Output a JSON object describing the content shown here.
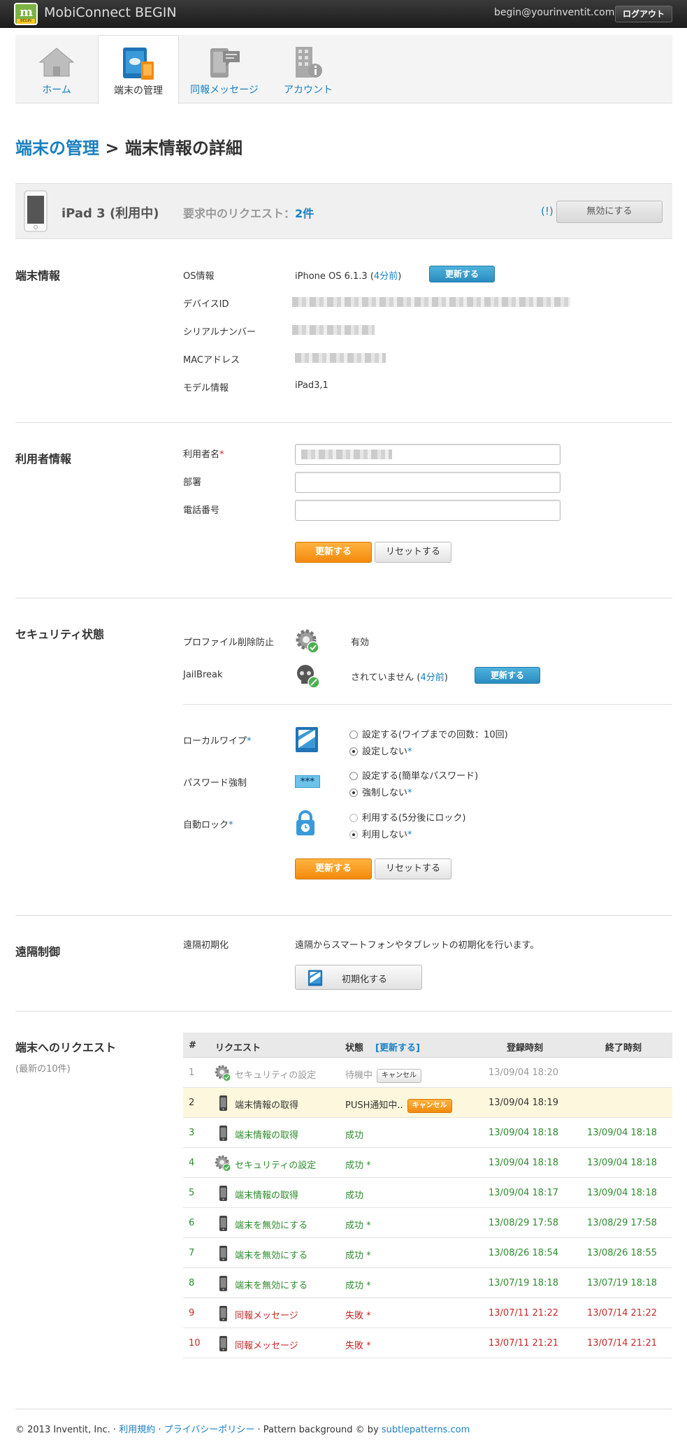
{
  "app": {
    "logo_letter": "m",
    "logo_badge": "BEGIN",
    "title": "MobiConnect BEGIN",
    "user_email": "begin@yourinventit.com",
    "logout_label": "ログアウト"
  },
  "nav": {
    "tabs": [
      {
        "label": "ホーム",
        "icon": "home-icon"
      },
      {
        "label": "端末の管理",
        "icon": "devices-icon"
      },
      {
        "label": "同報メッセージ",
        "icon": "message-icon"
      },
      {
        "label": "アカウント",
        "icon": "account-icon"
      }
    ]
  },
  "page": {
    "breadcrumb": "端末の管理",
    "separator": " > ",
    "title": "端末情報の詳細"
  },
  "device": {
    "name": "iPad 3 (利用中)",
    "requests_label": "要求中のリクエスト：",
    "requests_count": "2件",
    "info_link": "(!)",
    "disable_label": "無効にする"
  },
  "device_info": {
    "section_title": "端末情報",
    "os_label": "OS情報",
    "os_value": "iPhone OS 6.1.3 (",
    "os_age": "4分前",
    "os_close": ")",
    "update_label": "更新する",
    "device_id_label": "デバイスID",
    "serial_label": "シリアルナンバー",
    "mac_label": "MACアドレス",
    "model_label": "モデル情報",
    "model_value": "iPad3,1"
  },
  "user_info": {
    "section_title": "利用者情報",
    "name_label": "利用者名",
    "name_star": "*",
    "dept_label": "部署",
    "phone_label": "電話番号",
    "update_label": "更新する",
    "reset_label": "リセットする"
  },
  "security": {
    "section_title": "セキュリティ状態",
    "profile_label": "プロファイル削除防止",
    "profile_value": "有効",
    "jailbreak_label": "JailBreak",
    "jailbreak_value": "されていません (",
    "jailbreak_age": "4分前",
    "jailbreak_close": ")",
    "jb_update_label": "更新する",
    "local_wipe_label": "ローカルワイプ",
    "local_wipe_opt1": "設定する(ワイプまでの回数：10回)",
    "local_wipe_opt2": "設定しない",
    "password_label": "パスワード強制",
    "password_icon_text": "***",
    "password_opt1": "設定する(簡単なパスワード)",
    "password_opt2": "強制しない",
    "autolock_label": "自動ロック",
    "autolock_opt1": "利用する(5分後にロック)",
    "autolock_opt2": "利用しない",
    "star": "*",
    "update_label": "更新する",
    "reset_label": "リセットする"
  },
  "remote": {
    "section_title": "遠隔制御",
    "init_label": "遠隔初期化",
    "init_desc": "遠隔からスマートフォンやタブレットの初期化を行います。",
    "init_button": "初期化する"
  },
  "requests": {
    "section_title": "端末へのリクエスト",
    "section_sub": "(最新の10件)",
    "headers": {
      "num": "#",
      "request": "リクエスト",
      "status": "状態",
      "refresh": "[更新する]",
      "registered": "登録時刻",
      "finished": "終了時刻"
    },
    "cancel_label": "キャンセル",
    "rows": [
      {
        "num": "1",
        "icon": "gear-check-icon",
        "request": "セキュリティの設定",
        "status": "待機中",
        "registered": "13/09/04 18:20",
        "finished": "",
        "color": "gray",
        "cancel": "plain"
      },
      {
        "num": "2",
        "icon": "phone-icon",
        "request": "端末情報の取得",
        "status": "PUSH通知中..",
        "registered": "13/09/04 18:19",
        "finished": "",
        "color": "black",
        "cancel": "orange"
      },
      {
        "num": "3",
        "icon": "phone-icon",
        "request": "端末情報の取得",
        "status": "成功",
        "registered": "13/09/04 18:18",
        "finished": "13/09/04 18:18",
        "color": "green"
      },
      {
        "num": "4",
        "icon": "gear-check-icon",
        "request": "セキュリティの設定",
        "status": "成功 *",
        "registered": "13/09/04 18:18",
        "finished": "13/09/04 18:18",
        "color": "green"
      },
      {
        "num": "5",
        "icon": "phone-icon",
        "request": "端末情報の取得",
        "status": "成功",
        "registered": "13/09/04 18:17",
        "finished": "13/09/04 18:18",
        "color": "green"
      },
      {
        "num": "6",
        "icon": "phone-icon",
        "request": "端末を無効にする",
        "status": "成功 *",
        "registered": "13/08/29 17:58",
        "finished": "13/08/29 17:58",
        "color": "green"
      },
      {
        "num": "7",
        "icon": "phone-icon",
        "request": "端末を無効にする",
        "status": "成功 *",
        "registered": "13/08/26 18:54",
        "finished": "13/08/26 18:55",
        "color": "green"
      },
      {
        "num": "8",
        "icon": "phone-icon",
        "request": "端末を無効にする",
        "status": "成功 *",
        "registered": "13/07/19 18:18",
        "finished": "13/07/19 18:18",
        "color": "green"
      },
      {
        "num": "9",
        "icon": "phone-icon",
        "request": "同報メッセージ",
        "status": "失敗 *",
        "registered": "13/07/11 21:22",
        "finished": "13/07/14 21:22",
        "color": "red"
      },
      {
        "num": "10",
        "icon": "phone-icon",
        "request": "同報メッセージ",
        "status": "失敗 *",
        "registered": "13/07/11 21:21",
        "finished": "13/07/14 21:21",
        "color": "red"
      }
    ]
  },
  "footer": {
    "copyright": "© 2013 Inventit, Inc. · ",
    "terms": "利用規約",
    "sep": " · ",
    "privacy": "プライバシーポリシー",
    "pattern": " · Pattern background © by ",
    "subtle": "subtlepatterns.com"
  },
  "colors": {
    "accent": "#1a7fc1",
    "orange": "#f48a0c",
    "success": "#2e8b2e",
    "fail": "#c62828"
  }
}
